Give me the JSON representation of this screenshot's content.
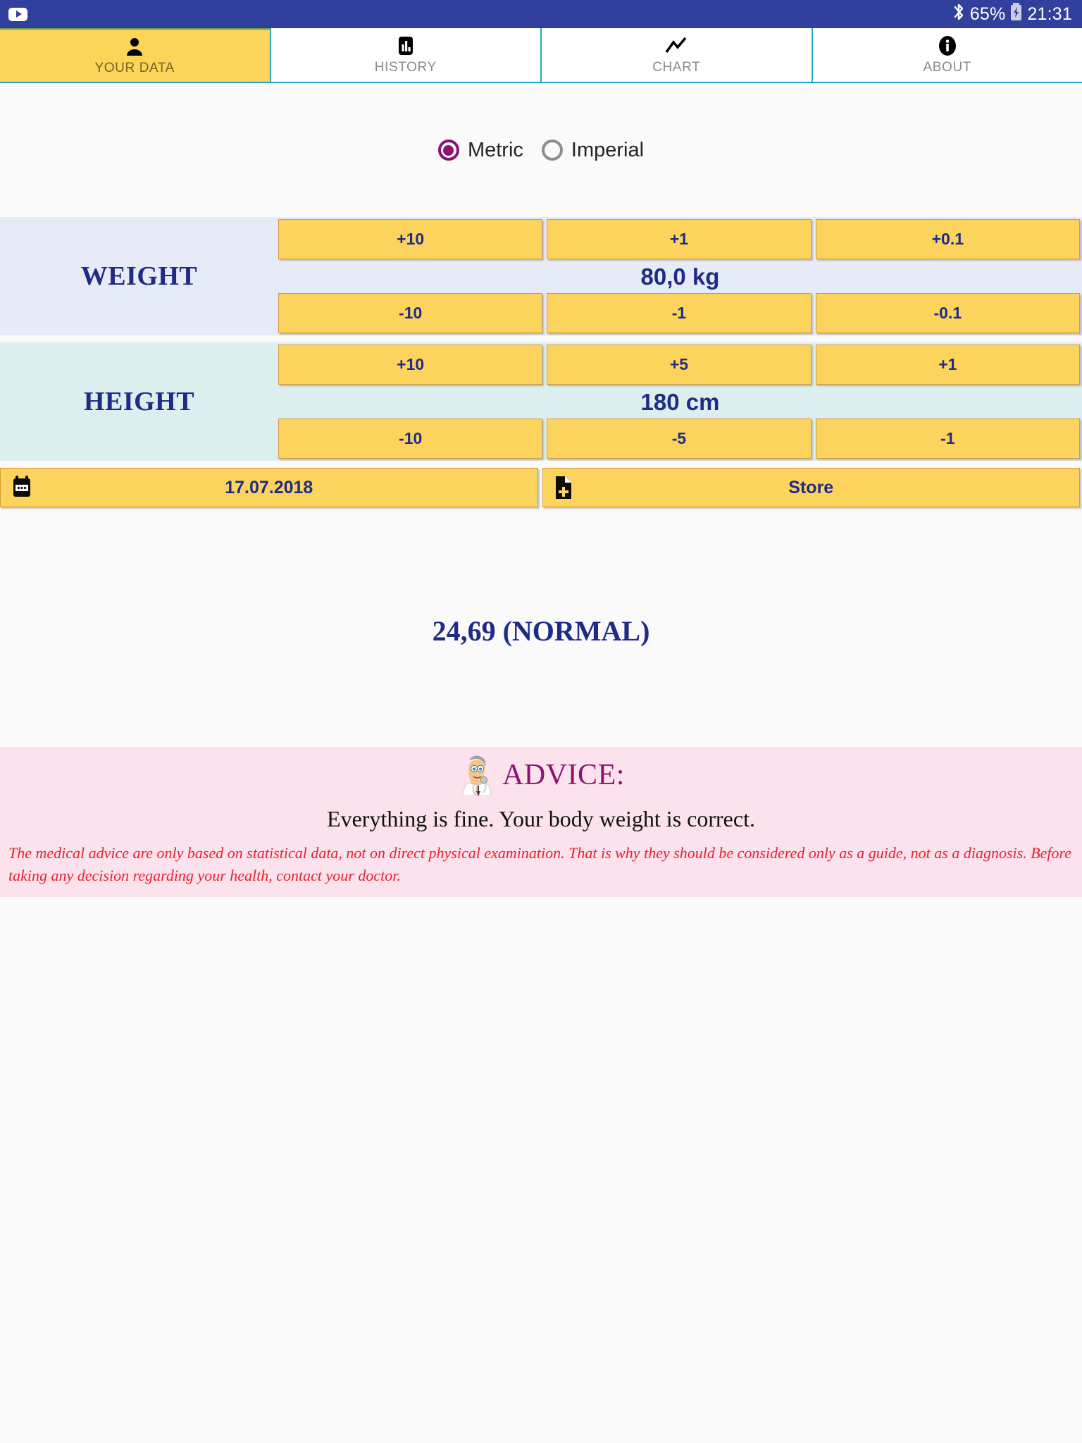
{
  "status_bar": {
    "notification_icon": "youtube-icon",
    "bluetooth_icon": "bluetooth-icon",
    "battery_percent": "65%",
    "battery_icon": "battery-charging-icon",
    "clock": "21:31",
    "background_color": "#31409c"
  },
  "tabs": [
    {
      "label": "YOUR DATA",
      "icon": "person-icon",
      "active": true
    },
    {
      "label": "HISTORY",
      "icon": "bar-chart-icon",
      "active": false
    },
    {
      "label": "CHART",
      "icon": "line-chart-icon",
      "active": false
    },
    {
      "label": "ABOUT",
      "icon": "info-icon",
      "active": false
    }
  ],
  "units": {
    "selected": "Metric",
    "options": [
      {
        "label": "Metric",
        "selected": true
      },
      {
        "label": "Imperial",
        "selected": false
      }
    ],
    "accent_color": "#8c1173"
  },
  "weight": {
    "title": "WEIGHT",
    "value": "80,0 kg",
    "increment_buttons": [
      "+10",
      "+1",
      "+0.1"
    ],
    "decrement_buttons": [
      "-10",
      "-1",
      "-0.1"
    ],
    "panel_color": "#e7eaf7"
  },
  "height": {
    "title": "HEIGHT",
    "value": "180 cm",
    "increment_buttons": [
      "+10",
      "+5",
      "+1"
    ],
    "decrement_buttons": [
      "-10",
      "-5",
      "-1"
    ],
    "panel_color": "#dcefee"
  },
  "actions": {
    "date_label": "17.07.2018",
    "date_icon": "calendar-icon",
    "store_label": "Store",
    "store_icon": "file-plus-icon",
    "button_color": "#fcd35d"
  },
  "bmi": {
    "result": "24,69 (NORMAL)",
    "text_color": "#1f2c86"
  },
  "advice": {
    "icon": "doctor-icon",
    "title": "ADVICE:",
    "message": "Everything is fine. Your body weight is correct.",
    "disclaimer": "The medical advice are only based on statistical data, not on direct physical examination. That is why they should be considered only as a guide, not as a diagnosis. Before taking any decision regarding your health, contact your doctor.",
    "panel_color": "#fbe2ec",
    "title_color": "#8c1173",
    "disclaimer_color": "#e8212e"
  }
}
